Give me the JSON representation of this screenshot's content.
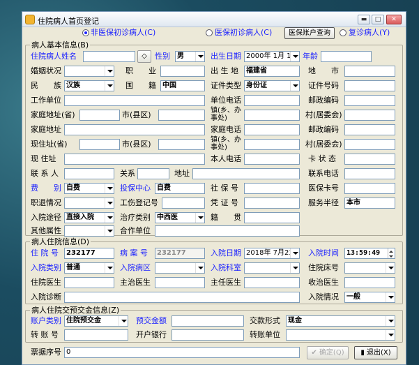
{
  "window": {
    "title": "住院病人首页登记",
    "min": "▬",
    "max": "□",
    "close": "✕"
  },
  "top": {
    "radio1": "非医保初诊病人(C)",
    "radio2": "医保初诊病人(C)",
    "btn_query": "医保账户查询",
    "radio3": "复诊病人(Y)"
  },
  "basic": {
    "title": "病人基本信息(B)",
    "name_label": "住院病人姓名",
    "name_value": "",
    "sex_label": "性别",
    "sex_value": "男",
    "birth_label": "出生日期",
    "birth_value": "2000年 1月 1",
    "age_label": "年龄",
    "age_value": "",
    "marital_label": "婚姻状况",
    "job_label": "职　　业",
    "birthplace_label": "出 生 地",
    "birthplace_value": "福建省",
    "city_label": "地　　市",
    "nation_label": "民　　族",
    "nation_value": "汉族",
    "country_label": "国　　籍",
    "country_value": "中国",
    "idtype_label": "证件类型",
    "idtype_value": "身份证",
    "idno_label": "证件号码",
    "work_label": "工作单位",
    "unitphone_label": "单位电话",
    "zip1_label": "邮政编码",
    "home_label": "家庭地址(省)",
    "county1_label": "市(县区)",
    "town1_label": "镇(乡、办事处)",
    "village1_label": "村(居委会)",
    "home2_label": "家庭地址",
    "homephone_label": "家庭电话",
    "zip2_label": "邮政编码",
    "cur_label": "现住址(省)",
    "county2_label": "市(县区)",
    "town2_label": "镇(乡、办事处)",
    "village2_label": "村(居委会)",
    "curaddr_label": "现 住址",
    "selfphone_label": "本人电话",
    "cardstatus_label": "卡 状 态",
    "contact_label": "联 系 人",
    "relation_label": "关系",
    "addr_label": "地址",
    "contactphone_label": "联系电话",
    "fee_label": "费　　别",
    "fee_value": "自费",
    "center_label": "投保中心",
    "center_value": "自费",
    "ss_label": "社 保 号",
    "card_label": "医保卡号",
    "jobcond_label": "职退情况",
    "injury_label": "工伤登记号",
    "voucher_label": "凭 证 号",
    "radius_label": "服务半径",
    "radius_value": "本市",
    "route_label": "入院途径",
    "route_value": "直接入院",
    "treat_label": "治疗类别",
    "treat_value": "中西医",
    "origin_label": "籍　　贯",
    "other_label": "其他属性",
    "coop_label": "合作单位"
  },
  "admit": {
    "title": "病人住院信息(D)",
    "no_label": "住 院 号",
    "no_value": "232177",
    "case_label": "病 案 号",
    "case_value": "232177",
    "date_label": "入院日期",
    "date_value": "2018年 7月23",
    "time_label": "入院时间",
    "time_value": "13:59:49",
    "type_label": "入院类别",
    "type_value": "普通",
    "ward_label": "入院病区",
    "dept_label": "入院科室",
    "bed_label": "住院床号",
    "doc_label": "住院医生",
    "chief_label": "主治医生",
    "director_label": "主任医生",
    "admit_doc_label": "收治医生",
    "diag_label": "入院诊断",
    "cond_label": "入院情况",
    "cond_value": "一般"
  },
  "deposit": {
    "title": "病人住院交预交金信息(Z)",
    "acct_label": "账户类别",
    "acct_value": "住院预交金",
    "amt_label": "预交金额",
    "paytype_label": "交款形式",
    "paytype_value": "现金",
    "transfer_label": "转 账 号",
    "bank_label": "开户银行",
    "tunit_label": "转账单位"
  },
  "footer": {
    "receipt_label": "票据序号",
    "receipt_value": "0",
    "ok": "✔ 确定(Q)",
    "exit": "退出(X)"
  }
}
